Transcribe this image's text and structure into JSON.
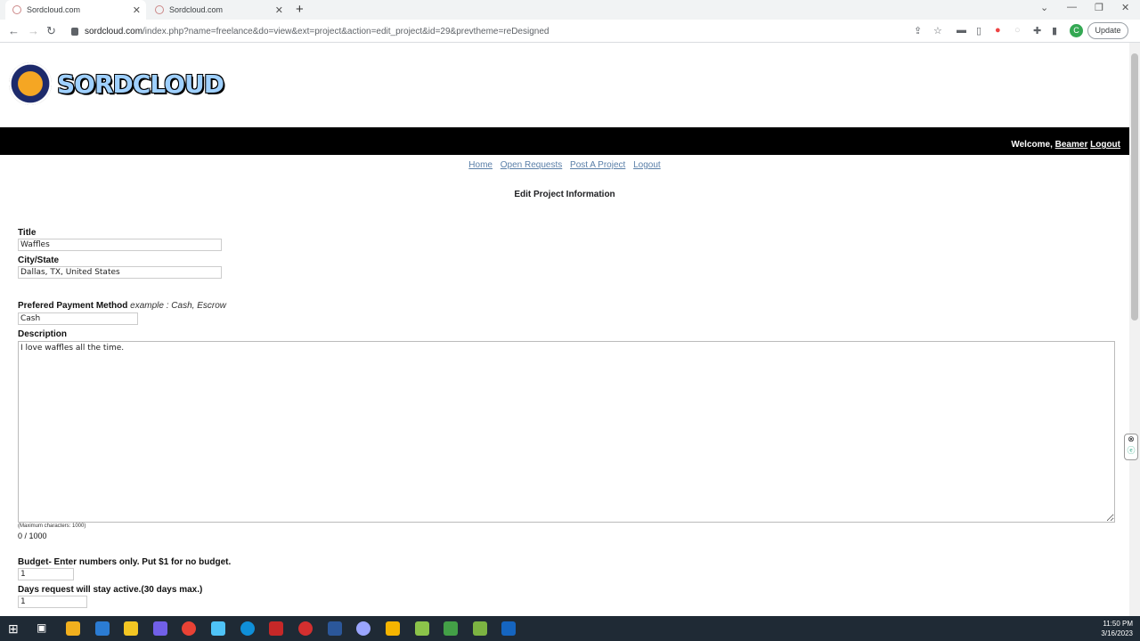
{
  "browser": {
    "tabs": [
      {
        "label": "Sordcloud.com",
        "active": true
      },
      {
        "label": "Sordcloud.com",
        "active": false
      }
    ],
    "url_host": "sordcloud.com",
    "url_path": "/index.php?name=freelance&do=view&ext=project&action=edit_project&id=29&prevtheme=reDesigned",
    "profile_initial": "C",
    "update_label": "Update"
  },
  "site": {
    "logo_text": "SORDCLOUD",
    "welcome_prefix": "Welcome,",
    "username": "Beamer",
    "logout_top": "Logout"
  },
  "nav": {
    "home": "Home",
    "open_requests": "Open Requests",
    "post_project": "Post A Project",
    "logout": "Logout"
  },
  "form": {
    "heading": "Edit Project Information",
    "title_label": "Title",
    "title_value": "Waffles",
    "city_label": "City/State",
    "city_value": "Dallas, TX, United States",
    "payment_label": "Prefered Payment Method",
    "payment_hint": "example : Cash, Escrow",
    "payment_value": "Cash",
    "description_label": "Description",
    "description_value": "I love waffles all the time.",
    "max_chars": "(Maximum characters: 1000)",
    "counter": "0 / 1000",
    "budget_label": "Budget- Enter numbers only. Put $1 for no budget.",
    "budget_value": "1",
    "days_label": "Days request will stay active.(30 days max.)",
    "days_value": "1"
  },
  "taskbar": {
    "time": "11:50 PM",
    "date": "3/16/2023"
  }
}
